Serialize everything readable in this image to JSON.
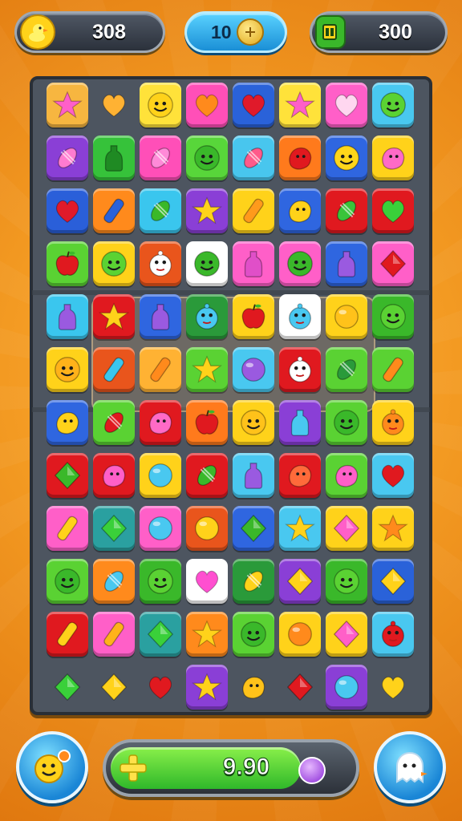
{
  "hud": {
    "left_value": "308",
    "middle_value": "10",
    "right_value": "300",
    "left_icon": "duck-icon",
    "middle_icon": "coin-icon",
    "right_icon": "battery-icon"
  },
  "footer": {
    "progress_value": "9.90",
    "progress_fraction": 0.78,
    "left_button_icon": "smiley-key-icon",
    "right_button_icon": "ghost-icon",
    "plus_icon": "plus-icon",
    "orb_icon": "orb-icon"
  },
  "colors": {
    "background": "#f39a22",
    "board": "#4d5560",
    "accent_blue": "#1a8fd6",
    "progress_green": "#2fb82a"
  },
  "board": {
    "rows": [
      [
        [
          "#f7b640",
          "star",
          "#ff5fc8"
        ],
        [
          "clear",
          "heart",
          "#ffb233"
        ],
        [
          "#ffe23a",
          "smile",
          "#ffd21a"
        ],
        [
          "#ff4fb8",
          "heart",
          "#ff8a1c"
        ],
        [
          "#2a62d9",
          "heart",
          "#e01a2a"
        ],
        [
          "#ffe23a",
          "star",
          "#ff5fc8"
        ],
        [
          "#ff5fc8",
          "heart",
          "#ffd7f0"
        ],
        [
          "#49c8f0",
          "smile",
          "#5ad233"
        ]
      ],
      [
        [
          "#8a3fd6",
          "candy",
          "#ff7bd0"
        ],
        [
          "#36c23a",
          "bottle",
          "#1f8a23"
        ],
        [
          "#ff4fb8",
          "candy",
          "#ff8ad8"
        ],
        [
          "#58d63a",
          "smile",
          "#3ab82a"
        ],
        [
          "#48c6ee",
          "candy",
          "#ff5a8a"
        ],
        [
          "#ff7a1c",
          "blob",
          "#e0191f"
        ],
        [
          "#2f66e0",
          "smile",
          "#ffd61a"
        ],
        [
          "#ffd21a",
          "blob",
          "#ff6ac6"
        ]
      ],
      [
        [
          "#2a5fd9",
          "heart",
          "#e01a2a"
        ],
        [
          "#ff8a1c",
          "stick",
          "#2a62d9"
        ],
        [
          "#3ac6ee",
          "candy",
          "#3ab82a"
        ],
        [
          "#8a3fd6",
          "star",
          "#ffd21a"
        ],
        [
          "#ffd21a",
          "stick",
          "#ff9a1c"
        ],
        [
          "#2f66e0",
          "blob",
          "#ffd21a"
        ],
        [
          "#e0191f",
          "candy",
          "#39c43a"
        ],
        [
          "#e0191f",
          "heart",
          "#3ad03a"
        ]
      ],
      [
        [
          "#5ad233",
          "apple",
          "#e0191f"
        ],
        [
          "#ffd21a",
          "smile",
          "#5ad233"
        ],
        [
          "#e9551c",
          "face",
          "#ffffff"
        ],
        [
          "#ffffff",
          "smile",
          "#3ab82a"
        ],
        [
          "#ff5fc8",
          "bottle",
          "#e04fc8"
        ],
        [
          "#ff5fc8",
          "smile",
          "#3ab82a"
        ],
        [
          "#2f66e0",
          "bottle",
          "#9a5ae0"
        ],
        [
          "#ff5fc8",
          "gem",
          "#e0191f"
        ]
      ],
      [
        [
          "#3ac6ee",
          "bottle",
          "#9a5ae0"
        ],
        [
          "#e0191f",
          "star",
          "#ffd21a"
        ],
        [
          "#2f66e0",
          "bottle",
          "#9a5ae0"
        ],
        [
          "#2a9a3a",
          "face",
          "#49c8f0"
        ],
        [
          "#ffd21a",
          "apple",
          "#e0191f"
        ],
        [
          "#ffffff",
          "face",
          "#49c8f0"
        ],
        [
          "#ffd21a",
          "orb",
          "#ffc21a"
        ],
        [
          "#3ab82a",
          "smile",
          "#5ad233"
        ]
      ],
      [
        [
          "#ffd21a",
          "smile",
          "#ffb21a"
        ],
        [
          "#e9551c",
          "stick",
          "#3ac6ee"
        ],
        [
          "#ffb233",
          "stick",
          "#ff8a1c"
        ],
        [
          "#5ad233",
          "star",
          "#ffd21a"
        ],
        [
          "#49c8f0",
          "orb",
          "#9a5ae0"
        ],
        [
          "#e0191f",
          "face",
          "#ffffff"
        ],
        [
          "#5ad233",
          "candy",
          "#2a9a3a"
        ],
        [
          "#5ad233",
          "stick",
          "#ff8a1c"
        ]
      ],
      [
        [
          "#2f66e0",
          "blob",
          "#ffd21a"
        ],
        [
          "#5ad233",
          "candy",
          "#e0191f"
        ],
        [
          "#e0191f",
          "blob",
          "#ff6ac6"
        ],
        [
          "#ff7a1c",
          "apple",
          "#e0191f"
        ],
        [
          "#ffd21a",
          "smile",
          "#ffc21a"
        ],
        [
          "#8a3fd6",
          "bottle",
          "#49c8f0"
        ],
        [
          "#5ad233",
          "smile",
          "#3ab82a"
        ],
        [
          "#ffd21a",
          "face",
          "#ff8a1c"
        ]
      ],
      [
        [
          "#e0191f",
          "gem",
          "#3ab82a"
        ],
        [
          "#e0191f",
          "blob",
          "#ff5fc8"
        ],
        [
          "#ffd21a",
          "orb",
          "#49c8f0"
        ],
        [
          "#e0191f",
          "candy",
          "#3ab82a"
        ],
        [
          "#49c8f0",
          "bottle",
          "#9a5ae0"
        ],
        [
          "#e0191f",
          "blob",
          "#ff6a3a"
        ],
        [
          "#5ad233",
          "blob",
          "#ff5fc8"
        ],
        [
          "#49c8f0",
          "heart",
          "#e0191f"
        ]
      ],
      [
        [
          "#ff5fc8",
          "stick",
          "#ffd21a"
        ],
        [
          "#2aa0a0",
          "gem",
          "#3ad03a"
        ],
        [
          "#ff5fc8",
          "orb",
          "#49c8f0"
        ],
        [
          "#e9551c",
          "orb",
          "#ffd21a"
        ],
        [
          "#2f66e0",
          "gem",
          "#3ab82a"
        ],
        [
          "#49c8f0",
          "star",
          "#ffd21a"
        ],
        [
          "#ffd21a",
          "gem",
          "#ff5fc8"
        ],
        [
          "#ffd21a",
          "star",
          "#ff8a1c"
        ]
      ],
      [
        [
          "#5ad233",
          "smile",
          "#3ab82a"
        ],
        [
          "#ff8a1c",
          "candy",
          "#49c8f0"
        ],
        [
          "#3ab82a",
          "smile",
          "#5ad233"
        ],
        [
          "#ffffff",
          "heart",
          "#ff4fd0"
        ],
        [
          "#2a9a3a",
          "candy",
          "#ffd21a"
        ],
        [
          "#8a3fd6",
          "gem",
          "#ffd21a"
        ],
        [
          "#3ab82a",
          "smile",
          "#5ad233"
        ],
        [
          "#2a62d9",
          "gem",
          "#ffd21a"
        ]
      ],
      [
        [
          "#e0191f",
          "stick",
          "#ffd21a"
        ],
        [
          "#ff5fc8",
          "stick",
          "#ffb21a"
        ],
        [
          "#2aa0a0",
          "gem",
          "#3ad03a"
        ],
        [
          "#ff8a1c",
          "star",
          "#ffd21a"
        ],
        [
          "#5ad233",
          "smile",
          "#3ab82a"
        ],
        [
          "#ffd21a",
          "orb",
          "#ff8a1c"
        ],
        [
          "#ffd21a",
          "gem",
          "#ff5fc8"
        ],
        [
          "#49c8f0",
          "face",
          "#e0191f"
        ]
      ],
      [
        [
          "clear",
          "gem",
          "#3ad03a"
        ],
        [
          "clear",
          "gem",
          "#ffd21a"
        ],
        [
          "clear",
          "heart",
          "#e0191f"
        ],
        [
          "#8a3fd6",
          "star",
          "#ffd21a"
        ],
        [
          "clear",
          "blob",
          "#ffc21a"
        ],
        [
          "clear",
          "gem",
          "#e0191f"
        ],
        [
          "#8a3fd6",
          "orb",
          "#49c8f0"
        ],
        [
          "clear",
          "heart",
          "#ffd21a"
        ]
      ]
    ]
  }
}
